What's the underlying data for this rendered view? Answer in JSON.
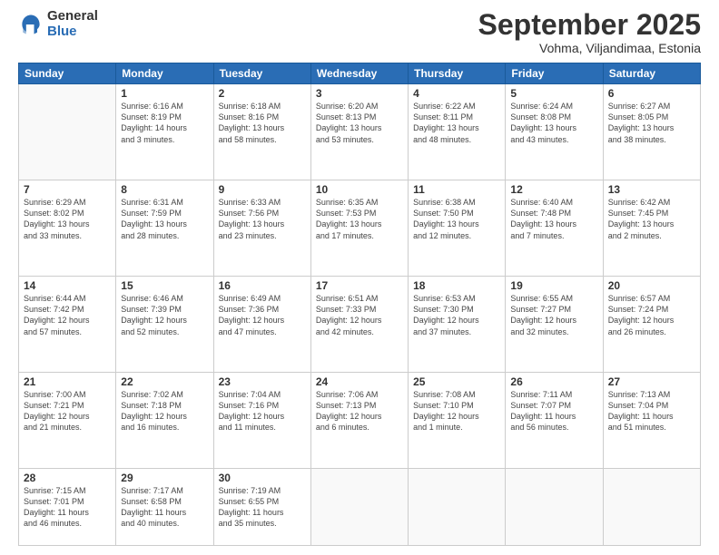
{
  "header": {
    "logo_general": "General",
    "logo_blue": "Blue",
    "title": "September 2025",
    "subtitle": "Vohma, Viljandimaa, Estonia"
  },
  "days_of_week": [
    "Sunday",
    "Monday",
    "Tuesday",
    "Wednesday",
    "Thursday",
    "Friday",
    "Saturday"
  ],
  "weeks": [
    [
      {
        "day": "",
        "info": ""
      },
      {
        "day": "1",
        "info": "Sunrise: 6:16 AM\nSunset: 8:19 PM\nDaylight: 14 hours\nand 3 minutes."
      },
      {
        "day": "2",
        "info": "Sunrise: 6:18 AM\nSunset: 8:16 PM\nDaylight: 13 hours\nand 58 minutes."
      },
      {
        "day": "3",
        "info": "Sunrise: 6:20 AM\nSunset: 8:13 PM\nDaylight: 13 hours\nand 53 minutes."
      },
      {
        "day": "4",
        "info": "Sunrise: 6:22 AM\nSunset: 8:11 PM\nDaylight: 13 hours\nand 48 minutes."
      },
      {
        "day": "5",
        "info": "Sunrise: 6:24 AM\nSunset: 8:08 PM\nDaylight: 13 hours\nand 43 minutes."
      },
      {
        "day": "6",
        "info": "Sunrise: 6:27 AM\nSunset: 8:05 PM\nDaylight: 13 hours\nand 38 minutes."
      }
    ],
    [
      {
        "day": "7",
        "info": "Sunrise: 6:29 AM\nSunset: 8:02 PM\nDaylight: 13 hours\nand 33 minutes."
      },
      {
        "day": "8",
        "info": "Sunrise: 6:31 AM\nSunset: 7:59 PM\nDaylight: 13 hours\nand 28 minutes."
      },
      {
        "day": "9",
        "info": "Sunrise: 6:33 AM\nSunset: 7:56 PM\nDaylight: 13 hours\nand 23 minutes."
      },
      {
        "day": "10",
        "info": "Sunrise: 6:35 AM\nSunset: 7:53 PM\nDaylight: 13 hours\nand 17 minutes."
      },
      {
        "day": "11",
        "info": "Sunrise: 6:38 AM\nSunset: 7:50 PM\nDaylight: 13 hours\nand 12 minutes."
      },
      {
        "day": "12",
        "info": "Sunrise: 6:40 AM\nSunset: 7:48 PM\nDaylight: 13 hours\nand 7 minutes."
      },
      {
        "day": "13",
        "info": "Sunrise: 6:42 AM\nSunset: 7:45 PM\nDaylight: 13 hours\nand 2 minutes."
      }
    ],
    [
      {
        "day": "14",
        "info": "Sunrise: 6:44 AM\nSunset: 7:42 PM\nDaylight: 12 hours\nand 57 minutes."
      },
      {
        "day": "15",
        "info": "Sunrise: 6:46 AM\nSunset: 7:39 PM\nDaylight: 12 hours\nand 52 minutes."
      },
      {
        "day": "16",
        "info": "Sunrise: 6:49 AM\nSunset: 7:36 PM\nDaylight: 12 hours\nand 47 minutes."
      },
      {
        "day": "17",
        "info": "Sunrise: 6:51 AM\nSunset: 7:33 PM\nDaylight: 12 hours\nand 42 minutes."
      },
      {
        "day": "18",
        "info": "Sunrise: 6:53 AM\nSunset: 7:30 PM\nDaylight: 12 hours\nand 37 minutes."
      },
      {
        "day": "19",
        "info": "Sunrise: 6:55 AM\nSunset: 7:27 PM\nDaylight: 12 hours\nand 32 minutes."
      },
      {
        "day": "20",
        "info": "Sunrise: 6:57 AM\nSunset: 7:24 PM\nDaylight: 12 hours\nand 26 minutes."
      }
    ],
    [
      {
        "day": "21",
        "info": "Sunrise: 7:00 AM\nSunset: 7:21 PM\nDaylight: 12 hours\nand 21 minutes."
      },
      {
        "day": "22",
        "info": "Sunrise: 7:02 AM\nSunset: 7:18 PM\nDaylight: 12 hours\nand 16 minutes."
      },
      {
        "day": "23",
        "info": "Sunrise: 7:04 AM\nSunset: 7:16 PM\nDaylight: 12 hours\nand 11 minutes."
      },
      {
        "day": "24",
        "info": "Sunrise: 7:06 AM\nSunset: 7:13 PM\nDaylight: 12 hours\nand 6 minutes."
      },
      {
        "day": "25",
        "info": "Sunrise: 7:08 AM\nSunset: 7:10 PM\nDaylight: 12 hours\nand 1 minute."
      },
      {
        "day": "26",
        "info": "Sunrise: 7:11 AM\nSunset: 7:07 PM\nDaylight: 11 hours\nand 56 minutes."
      },
      {
        "day": "27",
        "info": "Sunrise: 7:13 AM\nSunset: 7:04 PM\nDaylight: 11 hours\nand 51 minutes."
      }
    ],
    [
      {
        "day": "28",
        "info": "Sunrise: 7:15 AM\nSunset: 7:01 PM\nDaylight: 11 hours\nand 46 minutes."
      },
      {
        "day": "29",
        "info": "Sunrise: 7:17 AM\nSunset: 6:58 PM\nDaylight: 11 hours\nand 40 minutes."
      },
      {
        "day": "30",
        "info": "Sunrise: 7:19 AM\nSunset: 6:55 PM\nDaylight: 11 hours\nand 35 minutes."
      },
      {
        "day": "",
        "info": ""
      },
      {
        "day": "",
        "info": ""
      },
      {
        "day": "",
        "info": ""
      },
      {
        "day": "",
        "info": ""
      }
    ]
  ]
}
